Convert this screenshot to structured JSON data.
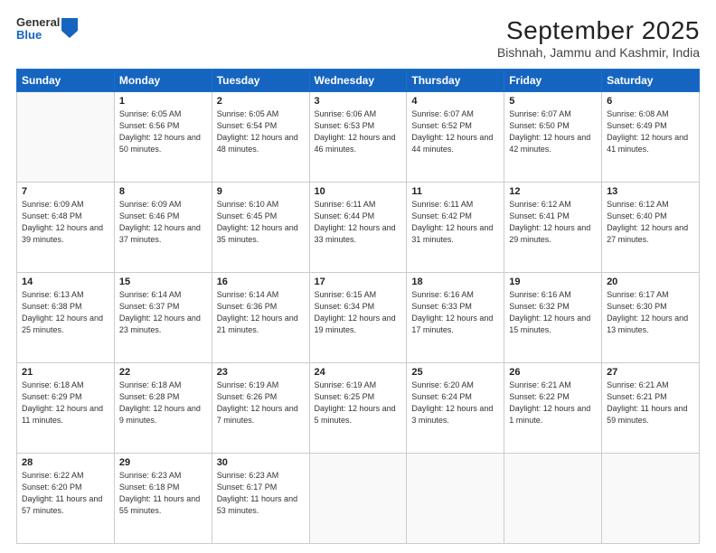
{
  "header": {
    "logo_general": "General",
    "logo_blue": "Blue",
    "title": "September 2025",
    "subtitle": "Bishnah, Jammu and Kashmir, India"
  },
  "weekdays": [
    "Sunday",
    "Monday",
    "Tuesday",
    "Wednesday",
    "Thursday",
    "Friday",
    "Saturday"
  ],
  "weeks": [
    [
      {
        "num": "",
        "sunrise": "",
        "sunset": "",
        "daylight": ""
      },
      {
        "num": "1",
        "sunrise": "Sunrise: 6:05 AM",
        "sunset": "Sunset: 6:56 PM",
        "daylight": "Daylight: 12 hours and 50 minutes."
      },
      {
        "num": "2",
        "sunrise": "Sunrise: 6:05 AM",
        "sunset": "Sunset: 6:54 PM",
        "daylight": "Daylight: 12 hours and 48 minutes."
      },
      {
        "num": "3",
        "sunrise": "Sunrise: 6:06 AM",
        "sunset": "Sunset: 6:53 PM",
        "daylight": "Daylight: 12 hours and 46 minutes."
      },
      {
        "num": "4",
        "sunrise": "Sunrise: 6:07 AM",
        "sunset": "Sunset: 6:52 PM",
        "daylight": "Daylight: 12 hours and 44 minutes."
      },
      {
        "num": "5",
        "sunrise": "Sunrise: 6:07 AM",
        "sunset": "Sunset: 6:50 PM",
        "daylight": "Daylight: 12 hours and 42 minutes."
      },
      {
        "num": "6",
        "sunrise": "Sunrise: 6:08 AM",
        "sunset": "Sunset: 6:49 PM",
        "daylight": "Daylight: 12 hours and 41 minutes."
      }
    ],
    [
      {
        "num": "7",
        "sunrise": "Sunrise: 6:09 AM",
        "sunset": "Sunset: 6:48 PM",
        "daylight": "Daylight: 12 hours and 39 minutes."
      },
      {
        "num": "8",
        "sunrise": "Sunrise: 6:09 AM",
        "sunset": "Sunset: 6:46 PM",
        "daylight": "Daylight: 12 hours and 37 minutes."
      },
      {
        "num": "9",
        "sunrise": "Sunrise: 6:10 AM",
        "sunset": "Sunset: 6:45 PM",
        "daylight": "Daylight: 12 hours and 35 minutes."
      },
      {
        "num": "10",
        "sunrise": "Sunrise: 6:11 AM",
        "sunset": "Sunset: 6:44 PM",
        "daylight": "Daylight: 12 hours and 33 minutes."
      },
      {
        "num": "11",
        "sunrise": "Sunrise: 6:11 AM",
        "sunset": "Sunset: 6:42 PM",
        "daylight": "Daylight: 12 hours and 31 minutes."
      },
      {
        "num": "12",
        "sunrise": "Sunrise: 6:12 AM",
        "sunset": "Sunset: 6:41 PM",
        "daylight": "Daylight: 12 hours and 29 minutes."
      },
      {
        "num": "13",
        "sunrise": "Sunrise: 6:12 AM",
        "sunset": "Sunset: 6:40 PM",
        "daylight": "Daylight: 12 hours and 27 minutes."
      }
    ],
    [
      {
        "num": "14",
        "sunrise": "Sunrise: 6:13 AM",
        "sunset": "Sunset: 6:38 PM",
        "daylight": "Daylight: 12 hours and 25 minutes."
      },
      {
        "num": "15",
        "sunrise": "Sunrise: 6:14 AM",
        "sunset": "Sunset: 6:37 PM",
        "daylight": "Daylight: 12 hours and 23 minutes."
      },
      {
        "num": "16",
        "sunrise": "Sunrise: 6:14 AM",
        "sunset": "Sunset: 6:36 PM",
        "daylight": "Daylight: 12 hours and 21 minutes."
      },
      {
        "num": "17",
        "sunrise": "Sunrise: 6:15 AM",
        "sunset": "Sunset: 6:34 PM",
        "daylight": "Daylight: 12 hours and 19 minutes."
      },
      {
        "num": "18",
        "sunrise": "Sunrise: 6:16 AM",
        "sunset": "Sunset: 6:33 PM",
        "daylight": "Daylight: 12 hours and 17 minutes."
      },
      {
        "num": "19",
        "sunrise": "Sunrise: 6:16 AM",
        "sunset": "Sunset: 6:32 PM",
        "daylight": "Daylight: 12 hours and 15 minutes."
      },
      {
        "num": "20",
        "sunrise": "Sunrise: 6:17 AM",
        "sunset": "Sunset: 6:30 PM",
        "daylight": "Daylight: 12 hours and 13 minutes."
      }
    ],
    [
      {
        "num": "21",
        "sunrise": "Sunrise: 6:18 AM",
        "sunset": "Sunset: 6:29 PM",
        "daylight": "Daylight: 12 hours and 11 minutes."
      },
      {
        "num": "22",
        "sunrise": "Sunrise: 6:18 AM",
        "sunset": "Sunset: 6:28 PM",
        "daylight": "Daylight: 12 hours and 9 minutes."
      },
      {
        "num": "23",
        "sunrise": "Sunrise: 6:19 AM",
        "sunset": "Sunset: 6:26 PM",
        "daylight": "Daylight: 12 hours and 7 minutes."
      },
      {
        "num": "24",
        "sunrise": "Sunrise: 6:19 AM",
        "sunset": "Sunset: 6:25 PM",
        "daylight": "Daylight: 12 hours and 5 minutes."
      },
      {
        "num": "25",
        "sunrise": "Sunrise: 6:20 AM",
        "sunset": "Sunset: 6:24 PM",
        "daylight": "Daylight: 12 hours and 3 minutes."
      },
      {
        "num": "26",
        "sunrise": "Sunrise: 6:21 AM",
        "sunset": "Sunset: 6:22 PM",
        "daylight": "Daylight: 12 hours and 1 minute."
      },
      {
        "num": "27",
        "sunrise": "Sunrise: 6:21 AM",
        "sunset": "Sunset: 6:21 PM",
        "daylight": "Daylight: 11 hours and 59 minutes."
      }
    ],
    [
      {
        "num": "28",
        "sunrise": "Sunrise: 6:22 AM",
        "sunset": "Sunset: 6:20 PM",
        "daylight": "Daylight: 11 hours and 57 minutes."
      },
      {
        "num": "29",
        "sunrise": "Sunrise: 6:23 AM",
        "sunset": "Sunset: 6:18 PM",
        "daylight": "Daylight: 11 hours and 55 minutes."
      },
      {
        "num": "30",
        "sunrise": "Sunrise: 6:23 AM",
        "sunset": "Sunset: 6:17 PM",
        "daylight": "Daylight: 11 hours and 53 minutes."
      },
      {
        "num": "",
        "sunrise": "",
        "sunset": "",
        "daylight": ""
      },
      {
        "num": "",
        "sunrise": "",
        "sunset": "",
        "daylight": ""
      },
      {
        "num": "",
        "sunrise": "",
        "sunset": "",
        "daylight": ""
      },
      {
        "num": "",
        "sunrise": "",
        "sunset": "",
        "daylight": ""
      }
    ]
  ]
}
